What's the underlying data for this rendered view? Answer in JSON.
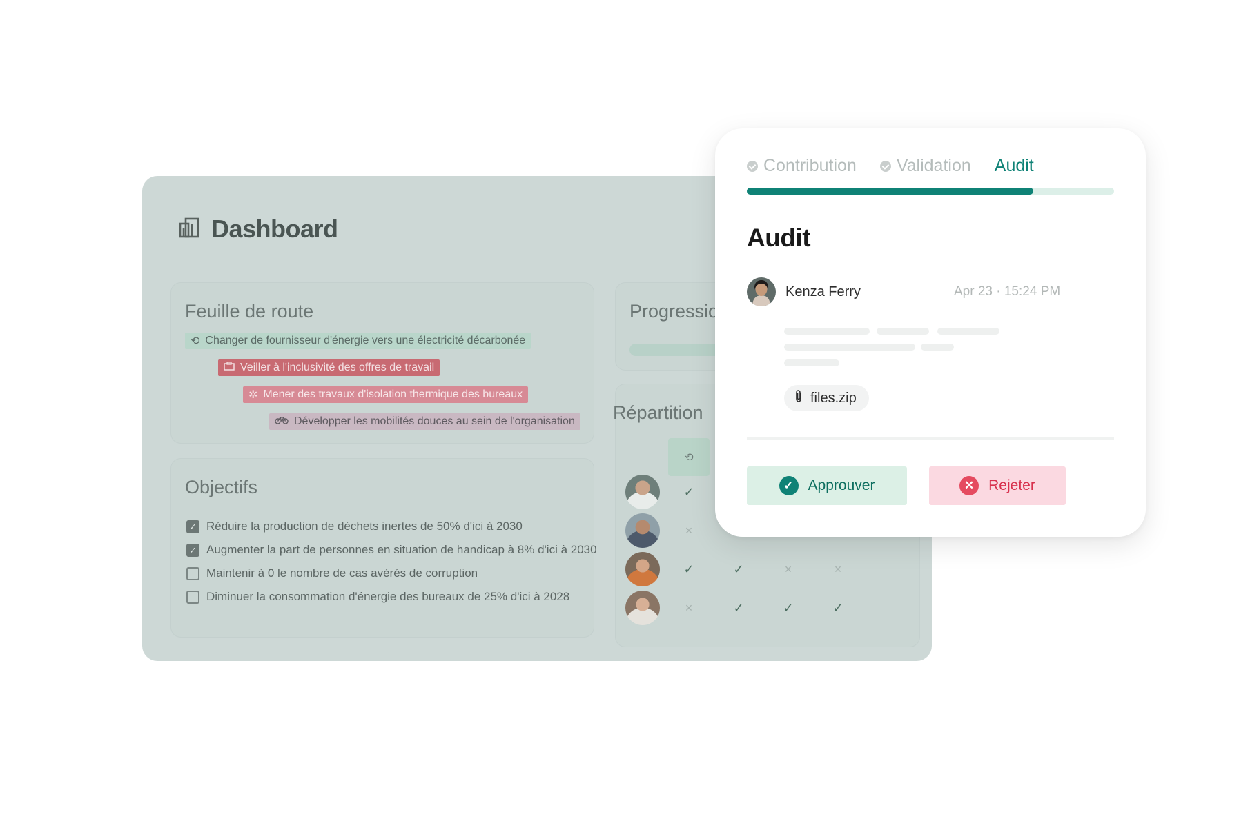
{
  "dashboard": {
    "title": "Dashboard",
    "roadmap": {
      "title": "Feuille de route",
      "items": [
        {
          "label": "Changer de fournisseur d'énergie vers une électricité décarbonée",
          "icon": "recycle-icon"
        },
        {
          "label": "Veiller à l'inclusivité des offres de travail",
          "icon": "briefcase-icon"
        },
        {
          "label": "Mener des travaux d'isolation thermique des bureaux",
          "icon": "snowflake-icon"
        },
        {
          "label": "Développer les mobilités douces au sein de l'organisation",
          "icon": "bicycle-icon"
        }
      ]
    },
    "objectives": {
      "title": "Objectifs",
      "items": [
        {
          "label": "Réduire la production de déchets inertes de 50% d'ici à 2030",
          "checked": true
        },
        {
          "label": "Augmenter la part de personnes en situation de handicap à 8% d'ici à 2030",
          "checked": true
        },
        {
          "label": "Maintenir à 0 le nombre de cas avérés de corruption",
          "checked": false
        },
        {
          "label": "Diminuer la consommation d'énergie des bureaux de 25% d'ici à 2028",
          "checked": false
        }
      ]
    },
    "progression": {
      "title": "Progression"
    },
    "repartition": {
      "title": "Répartition",
      "rows": [
        [
          "ok"
        ],
        [
          "no"
        ],
        [
          "ok",
          "ok",
          "no",
          "no"
        ],
        [
          "no",
          "ok",
          "ok",
          "ok"
        ]
      ]
    }
  },
  "audit_card": {
    "steps": [
      {
        "label": "Contribution",
        "state": "done"
      },
      {
        "label": "Validation",
        "state": "done"
      },
      {
        "label": "Audit",
        "state": "active"
      }
    ],
    "progress": 0.78,
    "title": "Audit",
    "author": {
      "name": "Kenza Ferry"
    },
    "timestamp": "Apr 23 · 15:24 PM",
    "attachment": "files.zip",
    "approve_label": "Approuver",
    "reject_label": "Rejeter"
  },
  "colors": {
    "accent": "#0f8276",
    "approve_bg": "#dcf0e6",
    "reject": "#e54b60",
    "reject_bg": "#fbd9e1"
  }
}
